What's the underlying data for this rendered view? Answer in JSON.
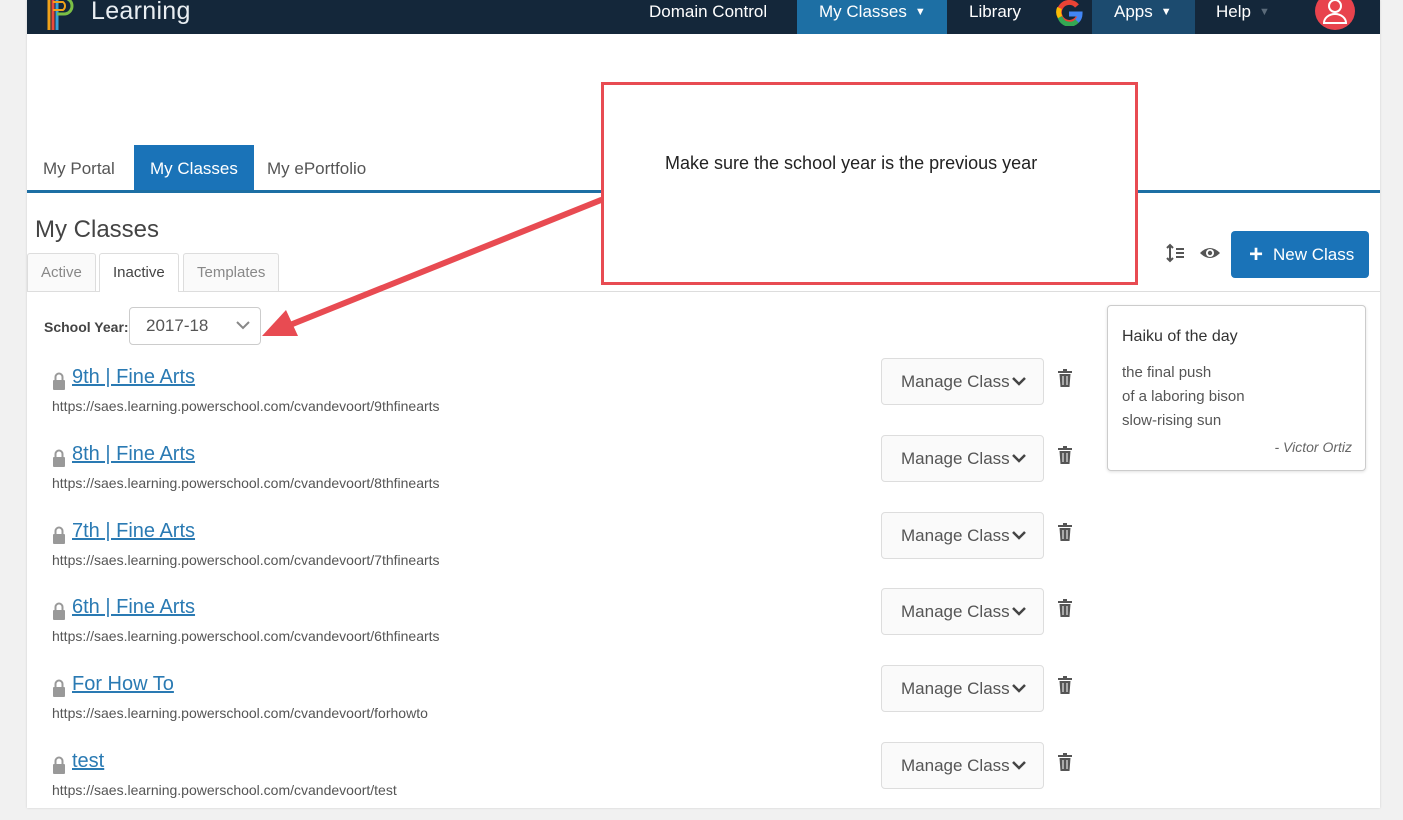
{
  "topnav": {
    "brand": "Learning",
    "items": [
      {
        "label": "Domain Control"
      },
      {
        "label": "My Classes"
      },
      {
        "label": "Library"
      },
      {
        "label": "Apps"
      },
      {
        "label": "Help"
      }
    ]
  },
  "main_tabs": [
    {
      "label": "My Portal"
    },
    {
      "label": "My Classes"
    },
    {
      "label": "My ePortfolio"
    }
  ],
  "section_title": "My Classes",
  "sub_tabs": [
    {
      "label": "Active"
    },
    {
      "label": "Inactive"
    },
    {
      "label": "Templates"
    }
  ],
  "new_class_label": "New Class",
  "school_year": {
    "label": "School Year:",
    "value": "2017-18"
  },
  "classes": [
    {
      "name": "9th | Fine Arts",
      "url": "https://saes.learning.powerschool.com/cvandevoort/9thfinearts",
      "action": "Manage Class"
    },
    {
      "name": "8th | Fine Arts",
      "url": "https://saes.learning.powerschool.com/cvandevoort/8thfinearts",
      "action": "Manage Class"
    },
    {
      "name": "7th | Fine Arts",
      "url": "https://saes.learning.powerschool.com/cvandevoort/7thfinearts",
      "action": "Manage Class"
    },
    {
      "name": "6th | Fine Arts",
      "url": "https://saes.learning.powerschool.com/cvandevoort/6thfinearts",
      "action": "Manage Class"
    },
    {
      "name": "For How To",
      "url": "https://saes.learning.powerschool.com/cvandevoort/forhowto",
      "action": "Manage Class"
    },
    {
      "name": "test",
      "url": "https://saes.learning.powerschool.com/cvandevoort/test",
      "action": "Manage Class"
    }
  ],
  "haiku": {
    "title": "Haiku of the day",
    "lines": [
      "the final push",
      "of a laboring bison",
      "slow-rising sun"
    ],
    "author": "- Victor Ortiz"
  },
  "annotation": {
    "text": "Make sure the school year is the previous year"
  },
  "colors": {
    "nav_bg": "#14273a",
    "accent": "#1a73b8",
    "annotation": "#e84b52"
  }
}
